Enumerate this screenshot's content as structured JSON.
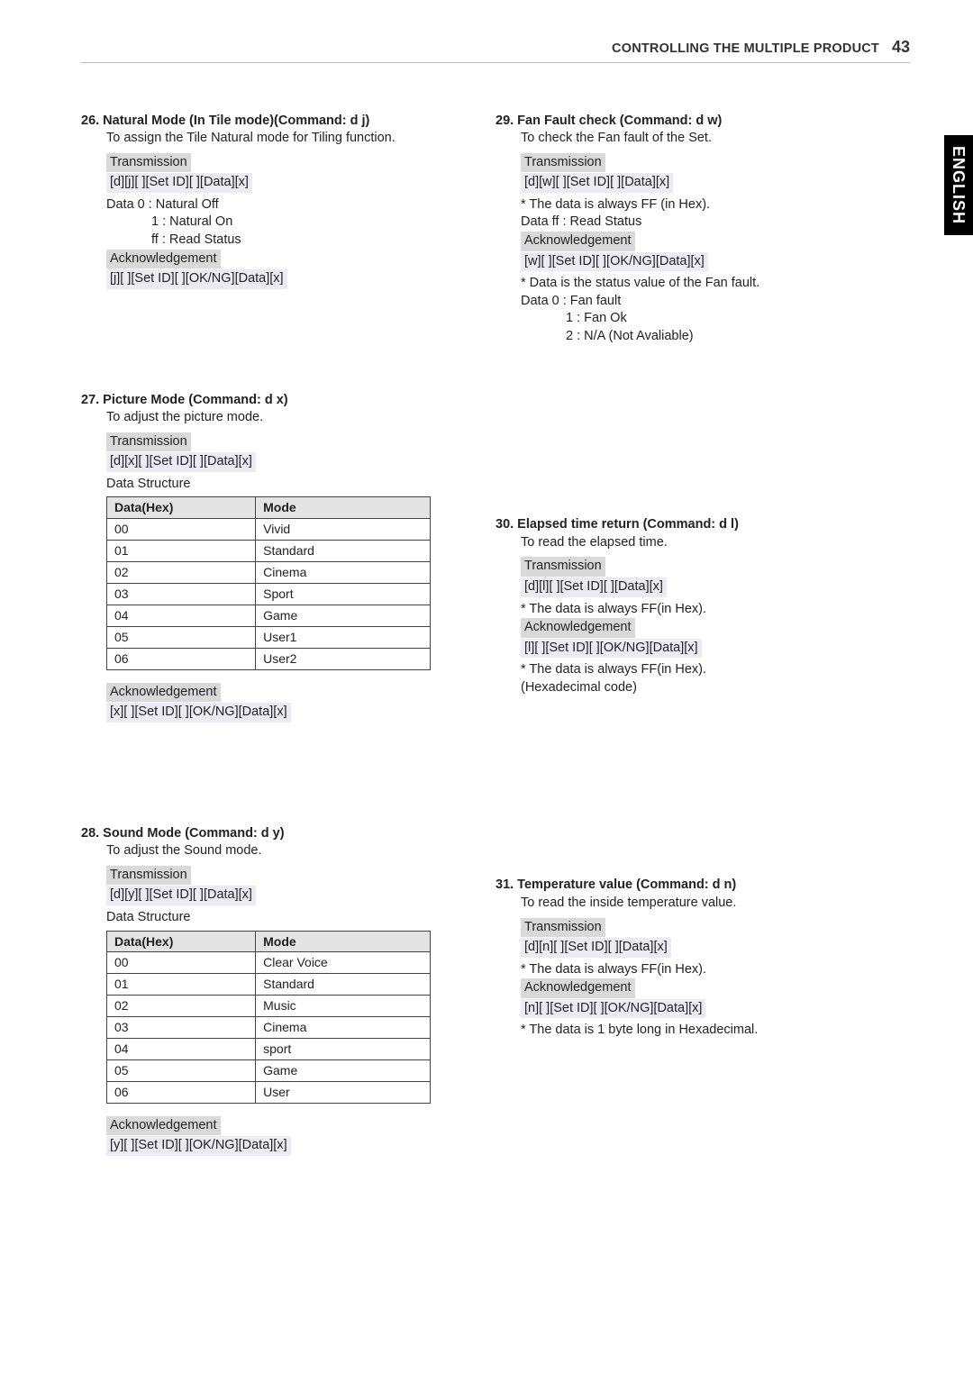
{
  "header": {
    "title": "CONTROLLING THE MULTIPLE PRODUCT",
    "page": "43"
  },
  "lang_tab": "ENGLISH",
  "labels": {
    "transmission": "Transmission",
    "acknowledgement": "Acknowledgement"
  },
  "table_headers": {
    "datahex": "Data(Hex)",
    "mode": "Mode"
  },
  "cmd26": {
    "title": "26. Natural Mode (In Tile mode)(Command: d j)",
    "desc": "To assign the Tile Natural mode for Tiling function.",
    "tx": "[d][j][ ][Set ID][ ][Data][x]",
    "data0": "Data  0 : Natural Off",
    "data1": "1 : Natural On",
    "data2": "ff : Read Status",
    "ack": "[j][ ][Set ID][ ][OK/NG][Data][x]"
  },
  "cmd27": {
    "title": "27. Picture Mode (Command: d x)",
    "desc": "To adjust the picture mode.",
    "tx": "[d][x][ ][Set ID][ ][Data][x]",
    "struct": "Data Structure",
    "rows": [
      {
        "hex": "00",
        "mode": "Vivid"
      },
      {
        "hex": "01",
        "mode": "Standard"
      },
      {
        "hex": "02",
        "mode": "Cinema"
      },
      {
        "hex": "03",
        "mode": "Sport"
      },
      {
        "hex": "04",
        "mode": "Game"
      },
      {
        "hex": "05",
        "mode": "User1"
      },
      {
        "hex": "06",
        "mode": "User2"
      }
    ],
    "ack": "[x][ ][Set ID][ ][OK/NG][Data][x]"
  },
  "cmd28": {
    "title": "28. Sound Mode (Command: d y)",
    "desc": "To adjust the Sound mode.",
    "tx": "[d][y][ ][Set ID][ ][Data][x]",
    "struct": "Data Structure",
    "rows": [
      {
        "hex": "00",
        "mode": "Clear Voice"
      },
      {
        "hex": "01",
        "mode": "Standard"
      },
      {
        "hex": "02",
        "mode": "Music"
      },
      {
        "hex": "03",
        "mode": "Cinema"
      },
      {
        "hex": "04",
        "mode": "sport"
      },
      {
        "hex": "05",
        "mode": "Game"
      },
      {
        "hex": "06",
        "mode": "User"
      }
    ],
    "ack": "[y][ ][Set ID][ ][OK/NG][Data][x]"
  },
  "cmd29": {
    "title": "29. Fan Fault check (Command: d w)",
    "desc": "To check the Fan fault of the Set.",
    "tx": "[d][w][ ][Set ID][ ][Data][x]",
    "note1": "* The data is always FF (in Hex).",
    "note2": "Data ff : Read Status",
    "ack": "[w][ ][Set ID][ ][OK/NG][Data][x]",
    "note3": "* Data is the status value of the Fan fault.",
    "data0": "Data  0 : Fan fault",
    "data1": "1 : Fan Ok",
    "data2": "2 : N/A (Not Avaliable)"
  },
  "cmd30": {
    "title": "30. Elapsed time return (Command: d l)",
    "desc": "To read the elapsed time.",
    "tx": "[d][l][ ][Set ID][ ][Data][x]",
    "note1": "* The data is always FF(in Hex).",
    "ack": "[l][ ][Set ID][ ][OK/NG][Data][x]",
    "note2": "* The data is always FF(in Hex).",
    "note3": "(Hexadecimal code)"
  },
  "cmd31": {
    "title": "31. Temperature value (Command: d n)",
    "desc": "To read the inside temperature value.",
    "tx": "[d][n][ ][Set ID][ ][Data][x]",
    "note1": "* The data is always FF(in Hex).",
    "ack": "[n][ ][Set ID][ ][OK/NG][Data][x]",
    "note2": "* The data  is 1 byte long in Hexadecimal."
  }
}
